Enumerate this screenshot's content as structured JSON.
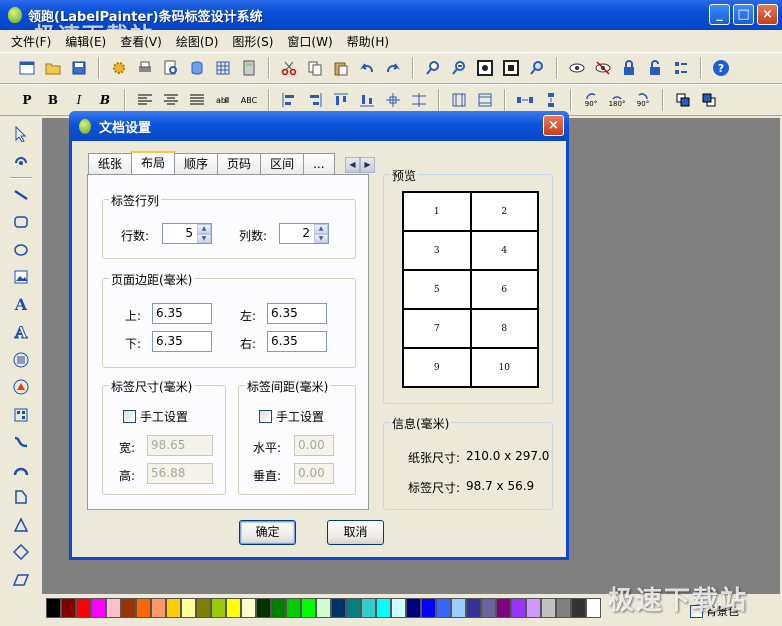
{
  "app": {
    "title": "领跑(LabelPainter)条码标签设计系统"
  },
  "window_buttons": {
    "minimize": "_",
    "maximize": "□",
    "close": "×"
  },
  "menu": [
    {
      "label": "文件(F)"
    },
    {
      "label": "编辑(E)"
    },
    {
      "label": "查看(V)"
    },
    {
      "label": "绘图(D)"
    },
    {
      "label": "图形(S)"
    },
    {
      "label": "窗口(W)"
    },
    {
      "label": "帮助(H)"
    }
  ],
  "format_toolbar": {
    "bold_p": "P",
    "bold": "B",
    "italic": "I",
    "bold_italic": "B",
    "abc": "ABC",
    "rot90": "90°",
    "rot180": "180°",
    "rot270": "90°"
  },
  "left_tools": {
    "text_tool": "A",
    "text_outline_tool": "A"
  },
  "palette": [
    "#000000",
    "#800000",
    "#FF0000",
    "#FF00FF",
    "#FFC0CB",
    "#993300",
    "#FF6600",
    "#FF9966",
    "#FFCC00",
    "#FFFF99",
    "#808000",
    "#99CC00",
    "#FFFF00",
    "#FFFFCC",
    "#003300",
    "#008000",
    "#00CC00",
    "#00FF00",
    "#CCFFCC",
    "#003366",
    "#008080",
    "#33CCCC",
    "#00FFFF",
    "#CCFFFF",
    "#000080",
    "#0000FF",
    "#3366FF",
    "#99CCFF",
    "#333399",
    "#666699",
    "#800080",
    "#9933FF",
    "#CC99FF",
    "#C0C0C0",
    "#808080",
    "#333333",
    "#FFFFFF"
  ],
  "background_check": {
    "label": "背景色"
  },
  "watermark": {
    "top_left": "极速下载站",
    "bottom_right": "极速下载站"
  },
  "dialog": {
    "title": "文档设置",
    "close": "×",
    "tabs": [
      "纸张",
      "布局",
      "顺序",
      "页码",
      "区间",
      "..."
    ],
    "active_tab": "布局",
    "tab_scroll": {
      "left": "◀",
      "right": "▶"
    },
    "rows_cols": {
      "group": "标签行列",
      "rows_label": "行数:",
      "rows_value": "5",
      "cols_label": "列数:",
      "cols_value": "2"
    },
    "margins": {
      "group": "页面边距(毫米)",
      "top_label": "上:",
      "top": "6.35",
      "left_label": "左:",
      "left": "6.35",
      "bottom_label": "下:",
      "bottom": "6.35",
      "right_label": "右:",
      "right": "6.35"
    },
    "label_size": {
      "group": "标签尺寸(毫米)",
      "manual": "手工设置",
      "width_label": "宽:",
      "width": "98.65",
      "height_label": "高:",
      "height": "56.88"
    },
    "label_spacing": {
      "group": "标签间距(毫米)",
      "manual": "手工设置",
      "h_label": "水平:",
      "h": "0.00",
      "v_label": "垂直:",
      "v": "0.00"
    },
    "preview": {
      "group": "预览",
      "cells": [
        "1",
        "2",
        "3",
        "4",
        "5",
        "6",
        "7",
        "8",
        "9",
        "10"
      ]
    },
    "info": {
      "group": "信息(毫米)",
      "paper_label": "纸张尺寸:",
      "paper": "210.0 x 297.0",
      "label_label": "标签尺寸:",
      "label": "98.7 x 56.9"
    },
    "ok": "确定",
    "cancel": "取消",
    "spin_up": "▲",
    "spin_down": "▼"
  }
}
